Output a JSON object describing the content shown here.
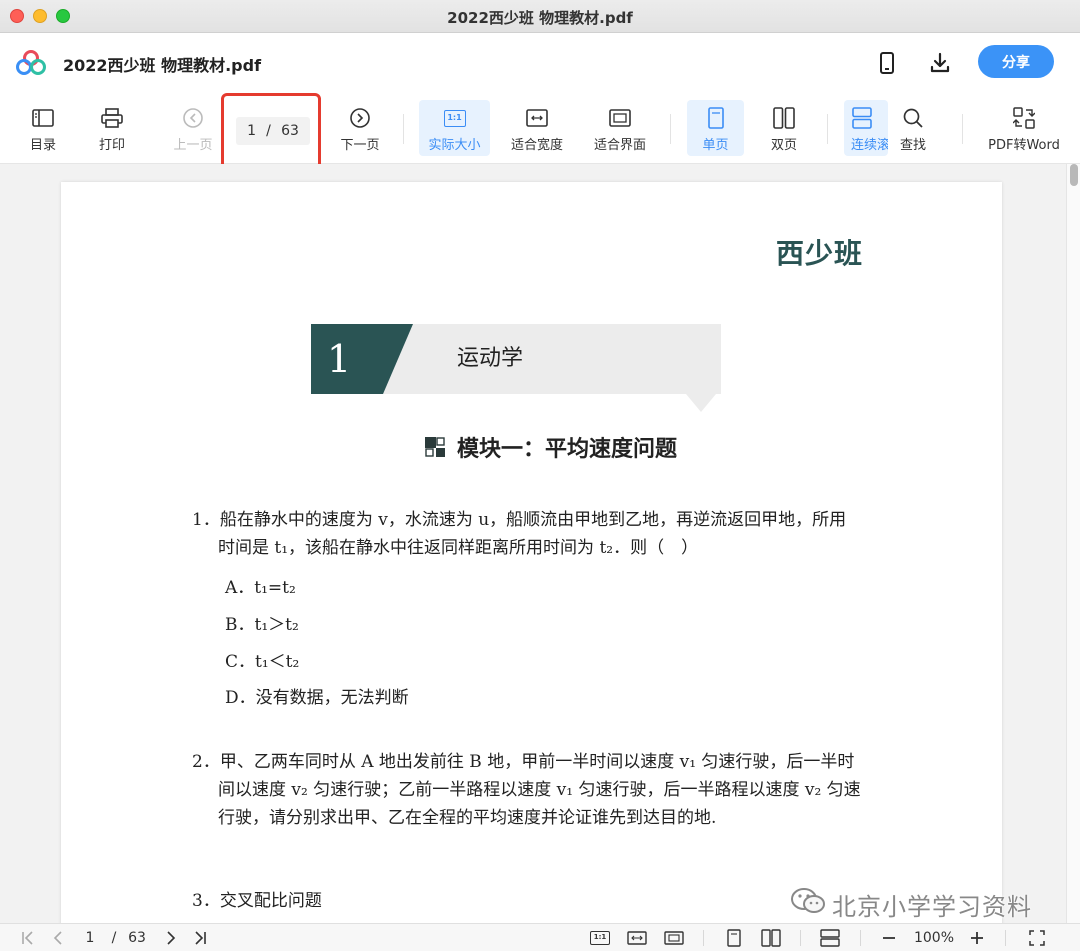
{
  "window": {
    "title": "2022西少班 物理教材.pdf"
  },
  "header": {
    "doc_name": "2022西少班 物理教材.pdf",
    "share_label": "分享"
  },
  "toolbar": {
    "toc": "目录",
    "print": "打印",
    "prev_page": "上一页",
    "current_page": "1",
    "page_sep": "/",
    "total_pages": "63",
    "next_page": "下一页",
    "actual_size": "实际大小",
    "fit_width": "适合宽度",
    "fit_page": "适合界面",
    "single_page": "单页",
    "double_page": "双页",
    "continuous": "连续滚",
    "find": "查找",
    "pdf_to_word": "PDF转Word",
    "actual_size_icon_text": "1:1"
  },
  "document": {
    "brand": "西少班",
    "chapter_number": "1",
    "chapter_title": "运动学",
    "module_title": "模块一：平均速度问题",
    "q1_line1": "1．船在静水中的速度为 v，水流速为 u，船顺流由甲地到乙地，再逆流返回甲地，所用",
    "q1_line2": "时间是 t₁，该船在静水中往返同样距离所用时间为 t₂．则（　）",
    "q1_options": [
      "A．t₁=t₂",
      "B．t₁＞t₂",
      "C．t₁＜t₂",
      "D．没有数据，无法判断"
    ],
    "q2_line1": "2．甲、乙两车同时从 A 地出发前往 B 地，甲前一半时间以速度 v₁ 匀速行驶，后一半时",
    "q2_line2": "间以速度 v₂ 匀速行驶；乙前一半路程以速度 v₁ 匀速行驶，后一半路程以速度 v₂ 匀速",
    "q2_line3": "行驶，请分别求出甲、乙在全程的平均速度并论证谁先到达目的地.",
    "q3_line1": "3．交叉配比问题"
  },
  "bottombar": {
    "current_page": "1",
    "page_sep": "/",
    "total_pages": "63",
    "actual_size_icon_text": "1:1",
    "zoom": "100%"
  },
  "watermark": {
    "text": "北京小学学习资料"
  },
  "colors": {
    "accent": "#3b93f7",
    "highlight": "#e53b2f",
    "brand": "#2a5454"
  }
}
